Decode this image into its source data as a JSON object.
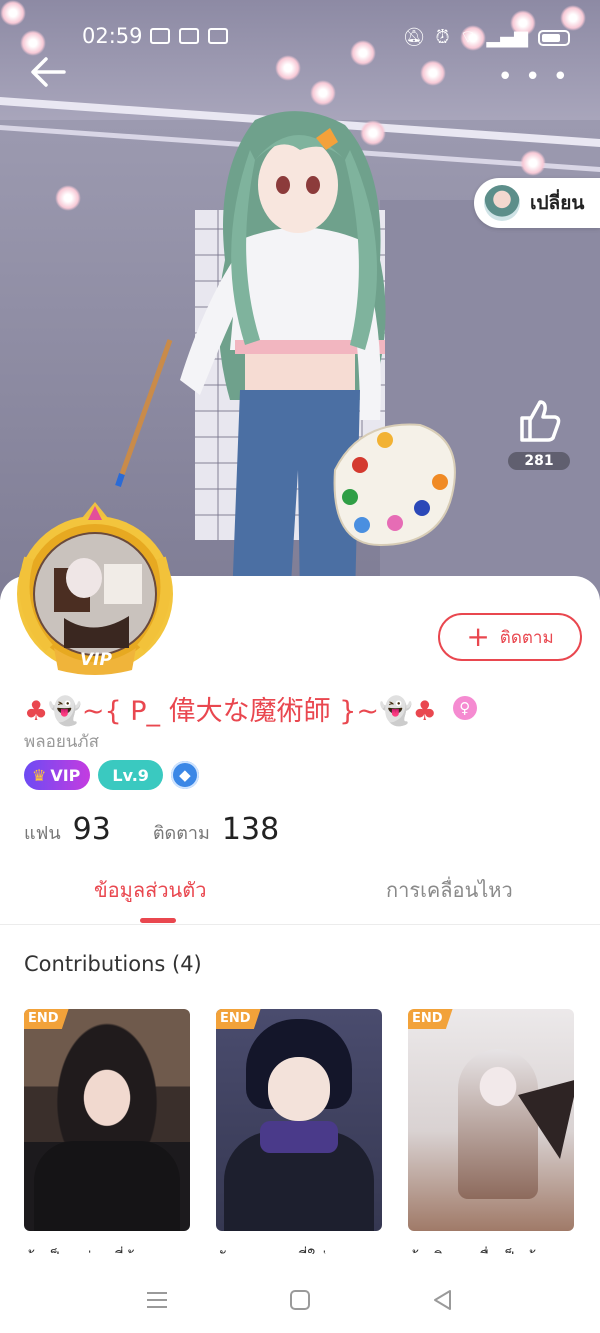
{
  "status_bar": {
    "time": "02:59",
    "left_icons": [
      "gallery-icon",
      "youtube-icon",
      "youtube-icon"
    ],
    "right_icons": [
      "mute-icon",
      "alarm-icon",
      "wifi-icon",
      "signal-icon",
      "battery-icon"
    ]
  },
  "header": {
    "back_icon": "arrow-left-icon",
    "more_icon": "more-dots-icon",
    "switch_label": "เปลี่ยน",
    "like_count": "281"
  },
  "profile": {
    "follow_label": "ติดตาม",
    "name_prefix": "♣👻~{ P_ 偉大な魔術師 }~👻♣",
    "gender_symbol": "♀",
    "subname": "พลอยนภัส",
    "badge_vip": "VIP",
    "badge_level": "Lv.9",
    "avatar_frame_label": "VIP",
    "fans_label": "แฟน",
    "fans_count": "93",
    "following_label": "ติดตาม",
    "following_count": "138"
  },
  "tabs": [
    {
      "label": "ข้อมูลส่วนตัว",
      "active": true
    },
    {
      "label": "การเคลื่อนไหว",
      "active": false
    }
  ],
  "contributions": {
    "title": "Contributions (4)",
    "items": [
      {
        "tag": "END",
        "caption": "ข้าเป็นแค่คนที่ข้า"
      },
      {
        "tag": "END",
        "caption": "ฉันจะหาคนที่ใช่"
      },
      {
        "tag": "END",
        "caption": "ข้าเกิดมาเพื่อเป็นข้า"
      }
    ]
  },
  "colors": {
    "accent": "#e9474f",
    "vip_gradient_start": "#6d4bf3",
    "vip_gradient_end": "#c43ce0",
    "level_badge": "#3ac9c0",
    "end_tag": "#f2a23a"
  }
}
